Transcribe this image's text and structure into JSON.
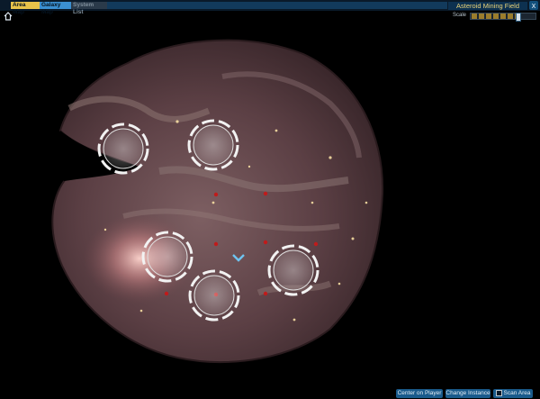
{
  "tabs": {
    "area_map": "Area Map",
    "galaxy_map": "Galaxy Map",
    "system_list": "System List"
  },
  "zone_title": "Asteroid Mining Field",
  "close_label": "x",
  "scale": {
    "label": "Scale",
    "level": 0.75
  },
  "map": {
    "waypoint_count": 5,
    "marker_icon": "chevron-down-icon"
  },
  "buttons": {
    "center_on_player": "Center on Player",
    "change_instance": "Change Instance",
    "scan_area": "Scan Area"
  },
  "colors": {
    "active_tab": "#e7c34a",
    "galaxy_tab": "#3b8fd0",
    "button": "#1a5b8c",
    "title_text": "#e9d37a"
  }
}
